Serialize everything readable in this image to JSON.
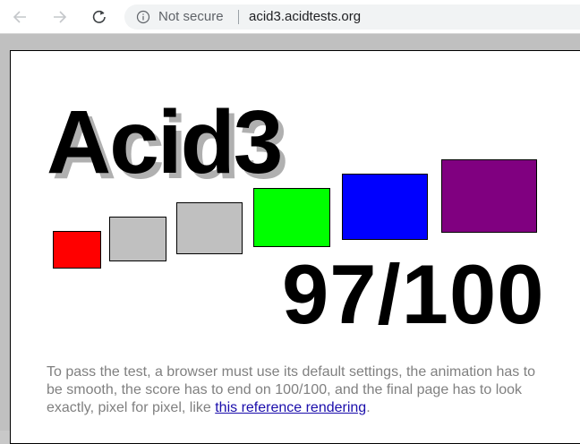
{
  "browser": {
    "security_label": "Not secure",
    "url": "acid3.acidtests.org"
  },
  "page": {
    "title": "Acid3",
    "score": "97/100",
    "info_text": "To pass the test, a browser must use its default settings, the animation has to be smooth, the score has to end on 100/100, and the final page has to look exactly, pixel for pixel, like ",
    "link_text": "this reference rendering",
    "info_end": ".",
    "boxes": [
      {
        "color": "#ff0000"
      },
      {
        "color": "#c0c0c0"
      },
      {
        "color": "#c0c0c0"
      },
      {
        "color": "#00ff00"
      },
      {
        "color": "#0000ff"
      },
      {
        "color": "#800080"
      }
    ]
  }
}
